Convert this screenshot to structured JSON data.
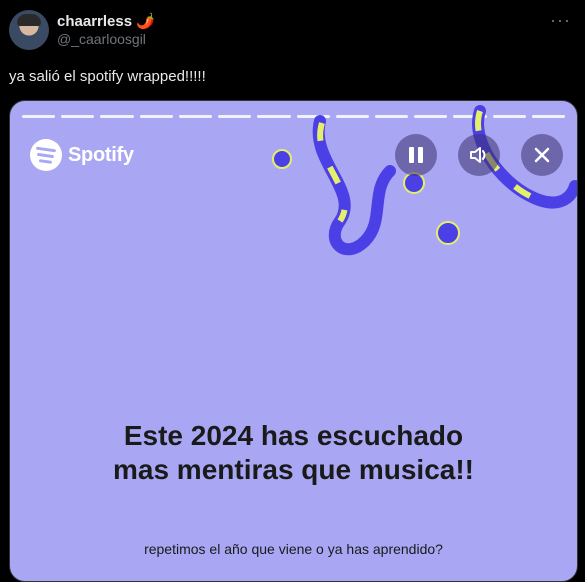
{
  "post": {
    "display_name": "chaarrless",
    "emoji": "🌶️",
    "handle": "@_caarloosgil",
    "more_icon": "more-dots-icon",
    "text": "ya salió el spotify wrapped!!!!!"
  },
  "story": {
    "brand": "Spotify",
    "segments": 14,
    "headline_line1": "Este 2024 has escuchado",
    "headline_line2": "mas mentiras que musica!!",
    "subtext": "repetimos el año que viene o ya has aprendido?",
    "controls": [
      "pause-icon",
      "volume-icon",
      "close-icon"
    ],
    "colors": {
      "background": "#a9a7f4",
      "accent_blue": "#4b3fe6",
      "accent_yellow": "#e4ef6a"
    }
  }
}
